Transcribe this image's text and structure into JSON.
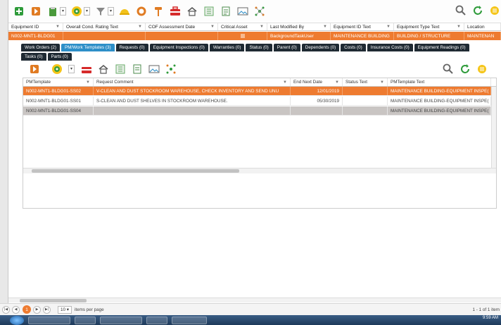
{
  "main_grid": {
    "columns": [
      "Equipment ID",
      "Overall Cond. Rating Text",
      "COF Assessment Date",
      "Critical Asset",
      "Last Modified By",
      "Equipment ID Text",
      "Equipment Type Text",
      "Location"
    ],
    "row": [
      "N002-MNT1-BLDG01",
      "",
      "",
      "",
      "BackgroundTaskUser",
      "MAINTENANCE BUILDING",
      "BUILDING / STRUCTURE",
      "MAINTENAN"
    ]
  },
  "tabs": [
    "Work Orders (2)",
    "PM/Work Templates (3)",
    "Requests (0)",
    "Equipment Inspections (0)",
    "Warranties (0)",
    "Status (0)",
    "Parent (0)",
    "Dependents (0)",
    "Costs (0)",
    "Insurance Costs (0)",
    "Equipment Readings (0)",
    "Tasks (0)",
    "Parts (0)"
  ],
  "active_tab_index": 1,
  "detail_grid": {
    "columns": [
      "PMTemplate",
      "Request Comment",
      "End Next Date",
      "Status Text",
      "PMTemplate Text"
    ],
    "rows": [
      {
        "pm": "N002-MNT1-BLDG01-SS02",
        "comment": "V-CLEAN AND DUST STOCKROOM WAREHOUSE, CHECK INVENTORY AND SEND UNU",
        "end": "12/01/2019",
        "status": "",
        "text": "MAINTENANCE BUILDING-EQUIPMENT INSPE("
      },
      {
        "pm": "N002-MNT1-BLDG01-SS01",
        "comment": "S-CLEAN AND DUST SHELVES IN STOCKROOM WAREHOUSE.",
        "end": "05/30/2019",
        "status": "",
        "text": "MAINTENANCE BUILDING-EQUIPMENT INSPE("
      },
      {
        "pm": "N002-MNT1-BLDG01-SS04",
        "comment": "",
        "end": "",
        "status": "",
        "text": "MAINTENANCE BUILDING-EQUIPMENT INSPE("
      }
    ]
  },
  "pager": {
    "current_page": "1",
    "page_size": "10",
    "items_label": "items per page",
    "info": "1 - 1 of 1 item"
  },
  "taskbar": {
    "clock": "9:59 AM"
  },
  "colors": {
    "accent": "#ee7b30",
    "active_tab": "#2d8fc8",
    "tab": "#1f2a33"
  }
}
